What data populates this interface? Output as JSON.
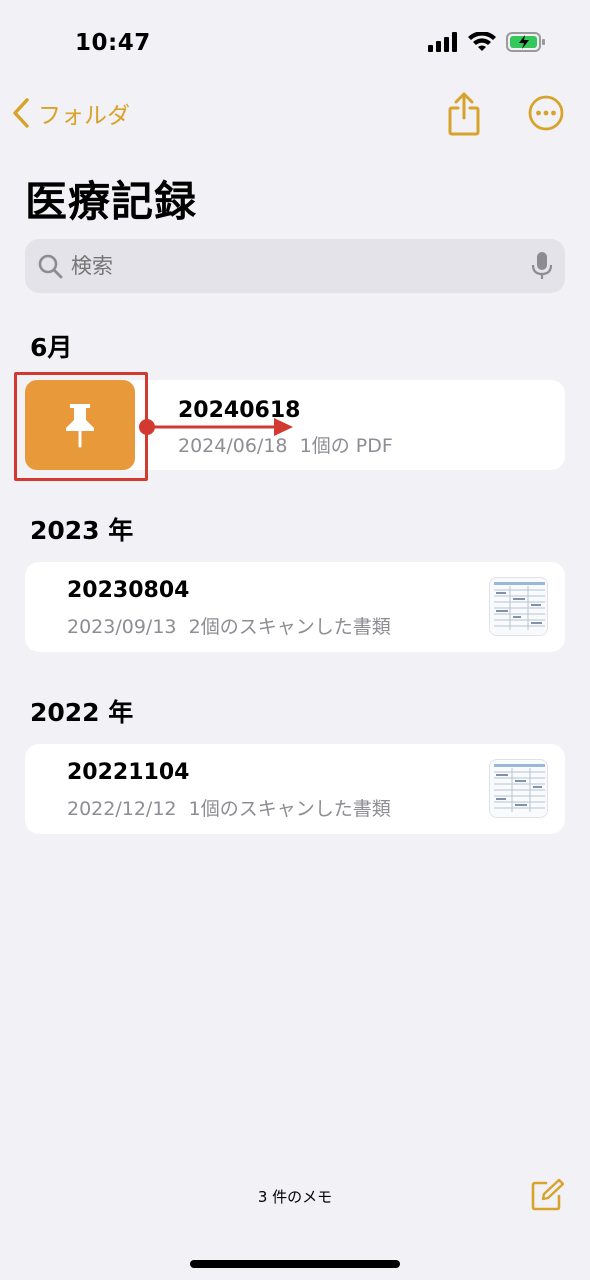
{
  "status_bar": {
    "time": "10:47"
  },
  "nav": {
    "back_label": "フォルダ"
  },
  "page_title": "医療記録",
  "search": {
    "placeholder": "検索"
  },
  "sections": [
    {
      "header": "6月",
      "notes": [
        {
          "title": "20240618",
          "date": "2024/06/18",
          "detail": "1個の PDF"
        }
      ]
    },
    {
      "header": "2023 年",
      "notes": [
        {
          "title": "20230804",
          "date": "2023/09/13",
          "detail": "2個のスキャンした書類"
        }
      ]
    },
    {
      "header": "2022 年",
      "notes": [
        {
          "title": "20221104",
          "date": "2022/12/12",
          "detail": "1個のスキャンした書類"
        }
      ]
    }
  ],
  "footer": {
    "note_count": "3 件のメモ"
  },
  "colors": {
    "accent": "#d8a32a",
    "pin_action": "#e8993a",
    "annotation": "#d33a2f",
    "background": "#f2f1f6"
  },
  "icons": [
    "chevron-left-icon",
    "share-icon",
    "more-icon",
    "search-icon",
    "mic-icon",
    "pin-icon",
    "compose-icon",
    "signal-icon",
    "wifi-icon",
    "battery-icon"
  ]
}
